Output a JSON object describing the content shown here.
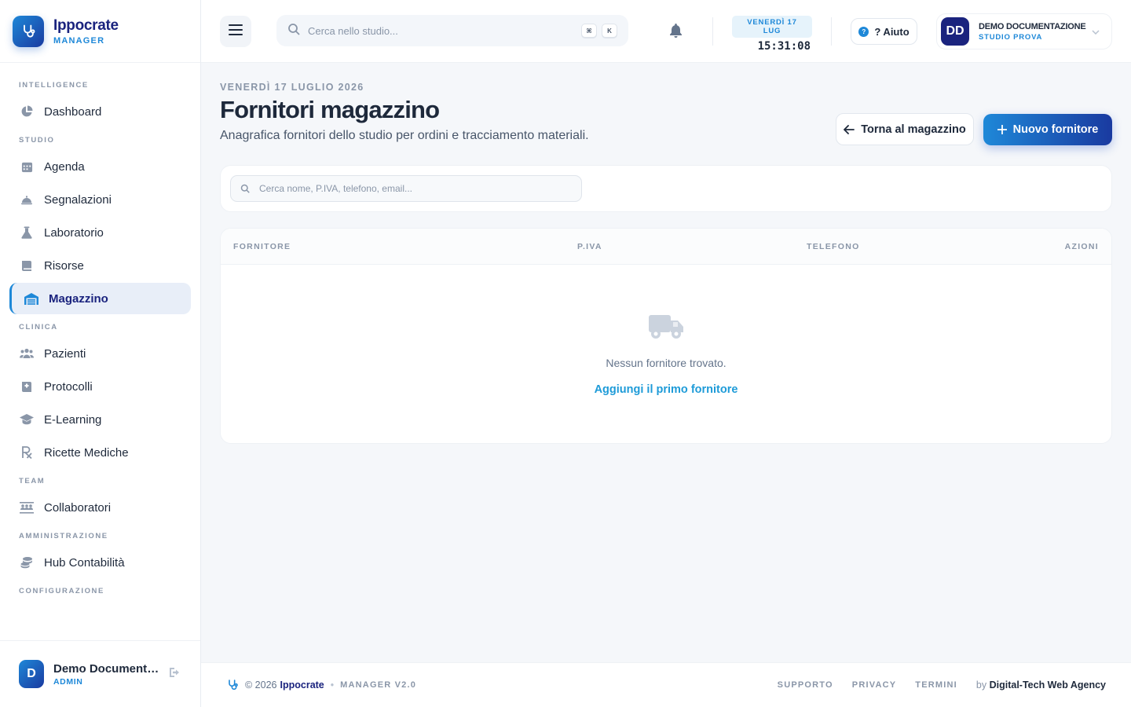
{
  "brand": {
    "title": "Ippocrate",
    "subtitle": "MANAGER"
  },
  "sidebar": {
    "sections": {
      "intelligence": "INTELLIGENCE",
      "studio": "STUDIO",
      "clinica": "CLINICA",
      "team": "TEAM",
      "amministrazione": "AMMINISTRAZIONE",
      "configurazione": "CONFIGURAZIONE"
    },
    "items": {
      "dashboard": "Dashboard",
      "agenda": "Agenda",
      "segnalazioni": "Segnalazioni",
      "laboratorio": "Laboratorio",
      "risorse": "Risorse",
      "magazzino": "Magazzino",
      "pazienti": "Pazienti",
      "protocolli": "Protocolli",
      "elearning": "E-Learning",
      "ricette": "Ricette Mediche",
      "collaboratori": "Collaboratori",
      "contabilita": "Hub Contabilità"
    },
    "active": "magazzino",
    "user": {
      "initial": "D",
      "name": "Demo Documentazione",
      "role": "ADMIN"
    }
  },
  "header": {
    "search_placeholder": "Cerca nello studio...",
    "shortcut_keys": [
      "⌘",
      "K"
    ],
    "date_label": "VENERDÌ 17 LUG",
    "time": "15:31:08",
    "help_label": "? Aiuto",
    "user": {
      "initials": "DD",
      "name": "DEMO DOCUMENTAZIONE",
      "studio": "STUDIO PROVA"
    }
  },
  "page": {
    "date": "VENERDÌ 17 LUGLIO 2026",
    "title": "Fornitori magazzino",
    "subtitle": "Anagrafica fornitori dello studio per ordini e tracciamento materiali.",
    "back_button": "Torna al magazzino",
    "new_button": "Nuovo fornitore",
    "filter_placeholder": "Cerca nome, P.IVA, telefono, email...",
    "table": {
      "columns": [
        "FORNITORE",
        "P.IVA",
        "TELEFONO",
        "AZIONI"
      ],
      "rows": [],
      "empty_text": "Nessun fornitore trovato.",
      "empty_link": "Aggiungi il primo fornitore"
    }
  },
  "footer": {
    "copyright": "© 2026",
    "brand": "Ippocrate",
    "version": "MANAGER V2.0",
    "links": [
      "SUPPORTO",
      "PRIVACY",
      "TERMINI"
    ],
    "by_label": "by",
    "agency": "Digital-Tech Web Agency"
  },
  "colors": {
    "accent": "#1e88d8",
    "brand_dark": "#1a237e",
    "active_bg": "#e8eef8"
  }
}
